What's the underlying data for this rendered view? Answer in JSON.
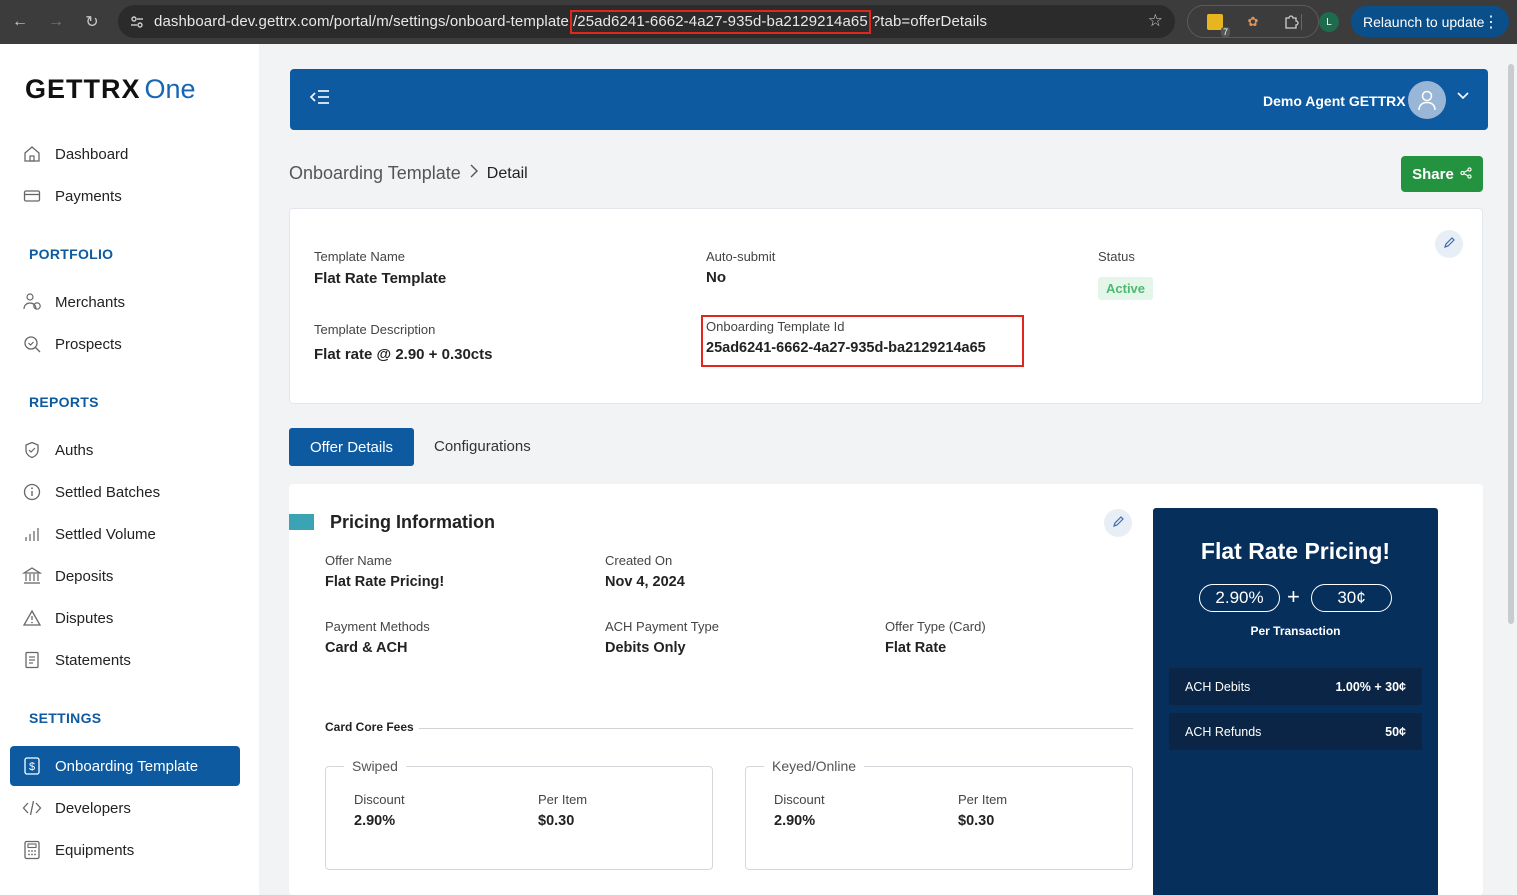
{
  "browser": {
    "url_prefix": "dashboard-dev.gettrx.com/portal/m/settings/onboard-template",
    "url_highlight": "/25ad6241-6662-4a27-935d-ba2129214a65",
    "url_suffix": "?tab=offerDetails",
    "profile_initial": "L",
    "extension_badge": "7",
    "relaunch_label": "Relaunch to update"
  },
  "sidebar": {
    "logo_main": "GETTRX",
    "logo_sub": "One",
    "items": [
      {
        "label": "Dashboard",
        "icon": "home-icon"
      },
      {
        "label": "Payments",
        "icon": "card-icon"
      },
      {
        "label": "Merchants",
        "icon": "users-icon"
      },
      {
        "label": "Prospects",
        "icon": "search-icon"
      },
      {
        "label": "Auths",
        "icon": "shield-icon"
      },
      {
        "label": "Settled Batches",
        "icon": "info-icon"
      },
      {
        "label": "Settled Volume",
        "icon": "bar-chart-icon"
      },
      {
        "label": "Deposits",
        "icon": "bank-icon"
      },
      {
        "label": "Disputes",
        "icon": "warning-icon"
      },
      {
        "label": "Statements",
        "icon": "receipt-icon"
      },
      {
        "label": "Onboarding Template",
        "icon": "dollar-doc-icon"
      },
      {
        "label": "Developers",
        "icon": "code-icon"
      },
      {
        "label": "Equipments",
        "icon": "calculator-icon"
      }
    ],
    "headings": {
      "portfolio": "PORTFOLIO",
      "reports": "REPORTS",
      "settings": "SETTINGS"
    }
  },
  "topbar": {
    "user_name": "Demo Agent GETTRX"
  },
  "breadcrumb": {
    "parent": "Onboarding Template",
    "current": "Detail"
  },
  "share_label": "Share",
  "template": {
    "name_label": "Template Name",
    "name_value": "Flat Rate Template",
    "autosubmit_label": "Auto-submit",
    "autosubmit_value": "No",
    "status_label": "Status",
    "status_value": "Active",
    "description_label": "Template Description",
    "description_value": "Flat rate @ 2.90 + 0.30cts",
    "id_label": "Onboarding Template Id",
    "id_value": "25ad6241-6662-4a27-935d-ba2129214a65"
  },
  "tabs": {
    "offer_details": "Offer Details",
    "configurations": "Configurations"
  },
  "pricing": {
    "title": "Pricing Information",
    "offer_name_label": "Offer Name",
    "offer_name_value": "Flat Rate Pricing!",
    "created_on_label": "Created On",
    "created_on_value": "Nov 4, 2024",
    "payment_methods_label": "Payment Methods",
    "payment_methods_value": "Card & ACH",
    "ach_type_label": "ACH Payment Type",
    "ach_type_value": "Debits Only",
    "offer_type_label": "Offer Type (Card)",
    "offer_type_value": "Flat Rate",
    "card_core_fees": "Card Core Fees",
    "swiped": {
      "legend": "Swiped",
      "discount_label": "Discount",
      "discount_value": "2.90%",
      "per_item_label": "Per Item",
      "per_item_value": "$0.30"
    },
    "keyed": {
      "legend": "Keyed/Online",
      "discount_label": "Discount",
      "discount_value": "2.90%",
      "per_item_label": "Per Item",
      "per_item_value": "$0.30"
    }
  },
  "offer_panel": {
    "title": "Flat Rate Pricing!",
    "rate": "2.90%",
    "plus": "+",
    "fixed": "30¢",
    "per_transaction": "Per Transaction",
    "ach_debits_label": "ACH Debits",
    "ach_debits_value": "1.00% + 30¢",
    "ach_refunds_label": "ACH Refunds",
    "ach_refunds_value": "50¢"
  }
}
